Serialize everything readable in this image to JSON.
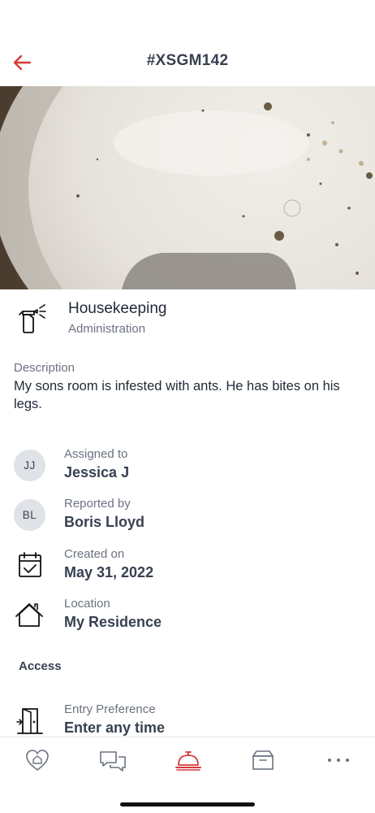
{
  "header": {
    "title": "#XSGM142",
    "back_icon": "arrow-left-icon"
  },
  "colors": {
    "accent": "#d63a3a",
    "text_primary": "#1f2937",
    "text_secondary": "#6b7280",
    "avatar_bg": "#dfe2e6"
  },
  "photo": {
    "icon": "photo"
  },
  "category": {
    "title": "Housekeeping",
    "subtitle": "Administration",
    "icon": "spray-bottle-icon"
  },
  "description": {
    "label": "Description",
    "text": "My sons room is infested with ants. He has bites on his legs."
  },
  "details": {
    "assigned": {
      "label": "Assigned to",
      "value": "Jessica J",
      "initials": "JJ"
    },
    "reported": {
      "label": "Reported by",
      "value": "Boris Lloyd",
      "initials": "BL"
    },
    "created": {
      "label": "Created on",
      "value": "May 31, 2022",
      "icon": "calendar-check-icon"
    },
    "location": {
      "label": "Location",
      "value": "My Residence",
      "icon": "house-icon"
    }
  },
  "access": {
    "heading": "Access",
    "entry": {
      "label": "Entry Preference",
      "value": "Enter any time",
      "icon": "door-icon"
    }
  },
  "tabs": [
    {
      "name": "home",
      "icon": "heart-home-icon",
      "active": false
    },
    {
      "name": "messages",
      "icon": "chat-bubbles-icon",
      "active": false
    },
    {
      "name": "requests",
      "icon": "service-bell-icon",
      "active": true
    },
    {
      "name": "packages",
      "icon": "archive-box-icon",
      "active": false
    },
    {
      "name": "more",
      "icon": "more-dots-icon",
      "active": false
    }
  ]
}
